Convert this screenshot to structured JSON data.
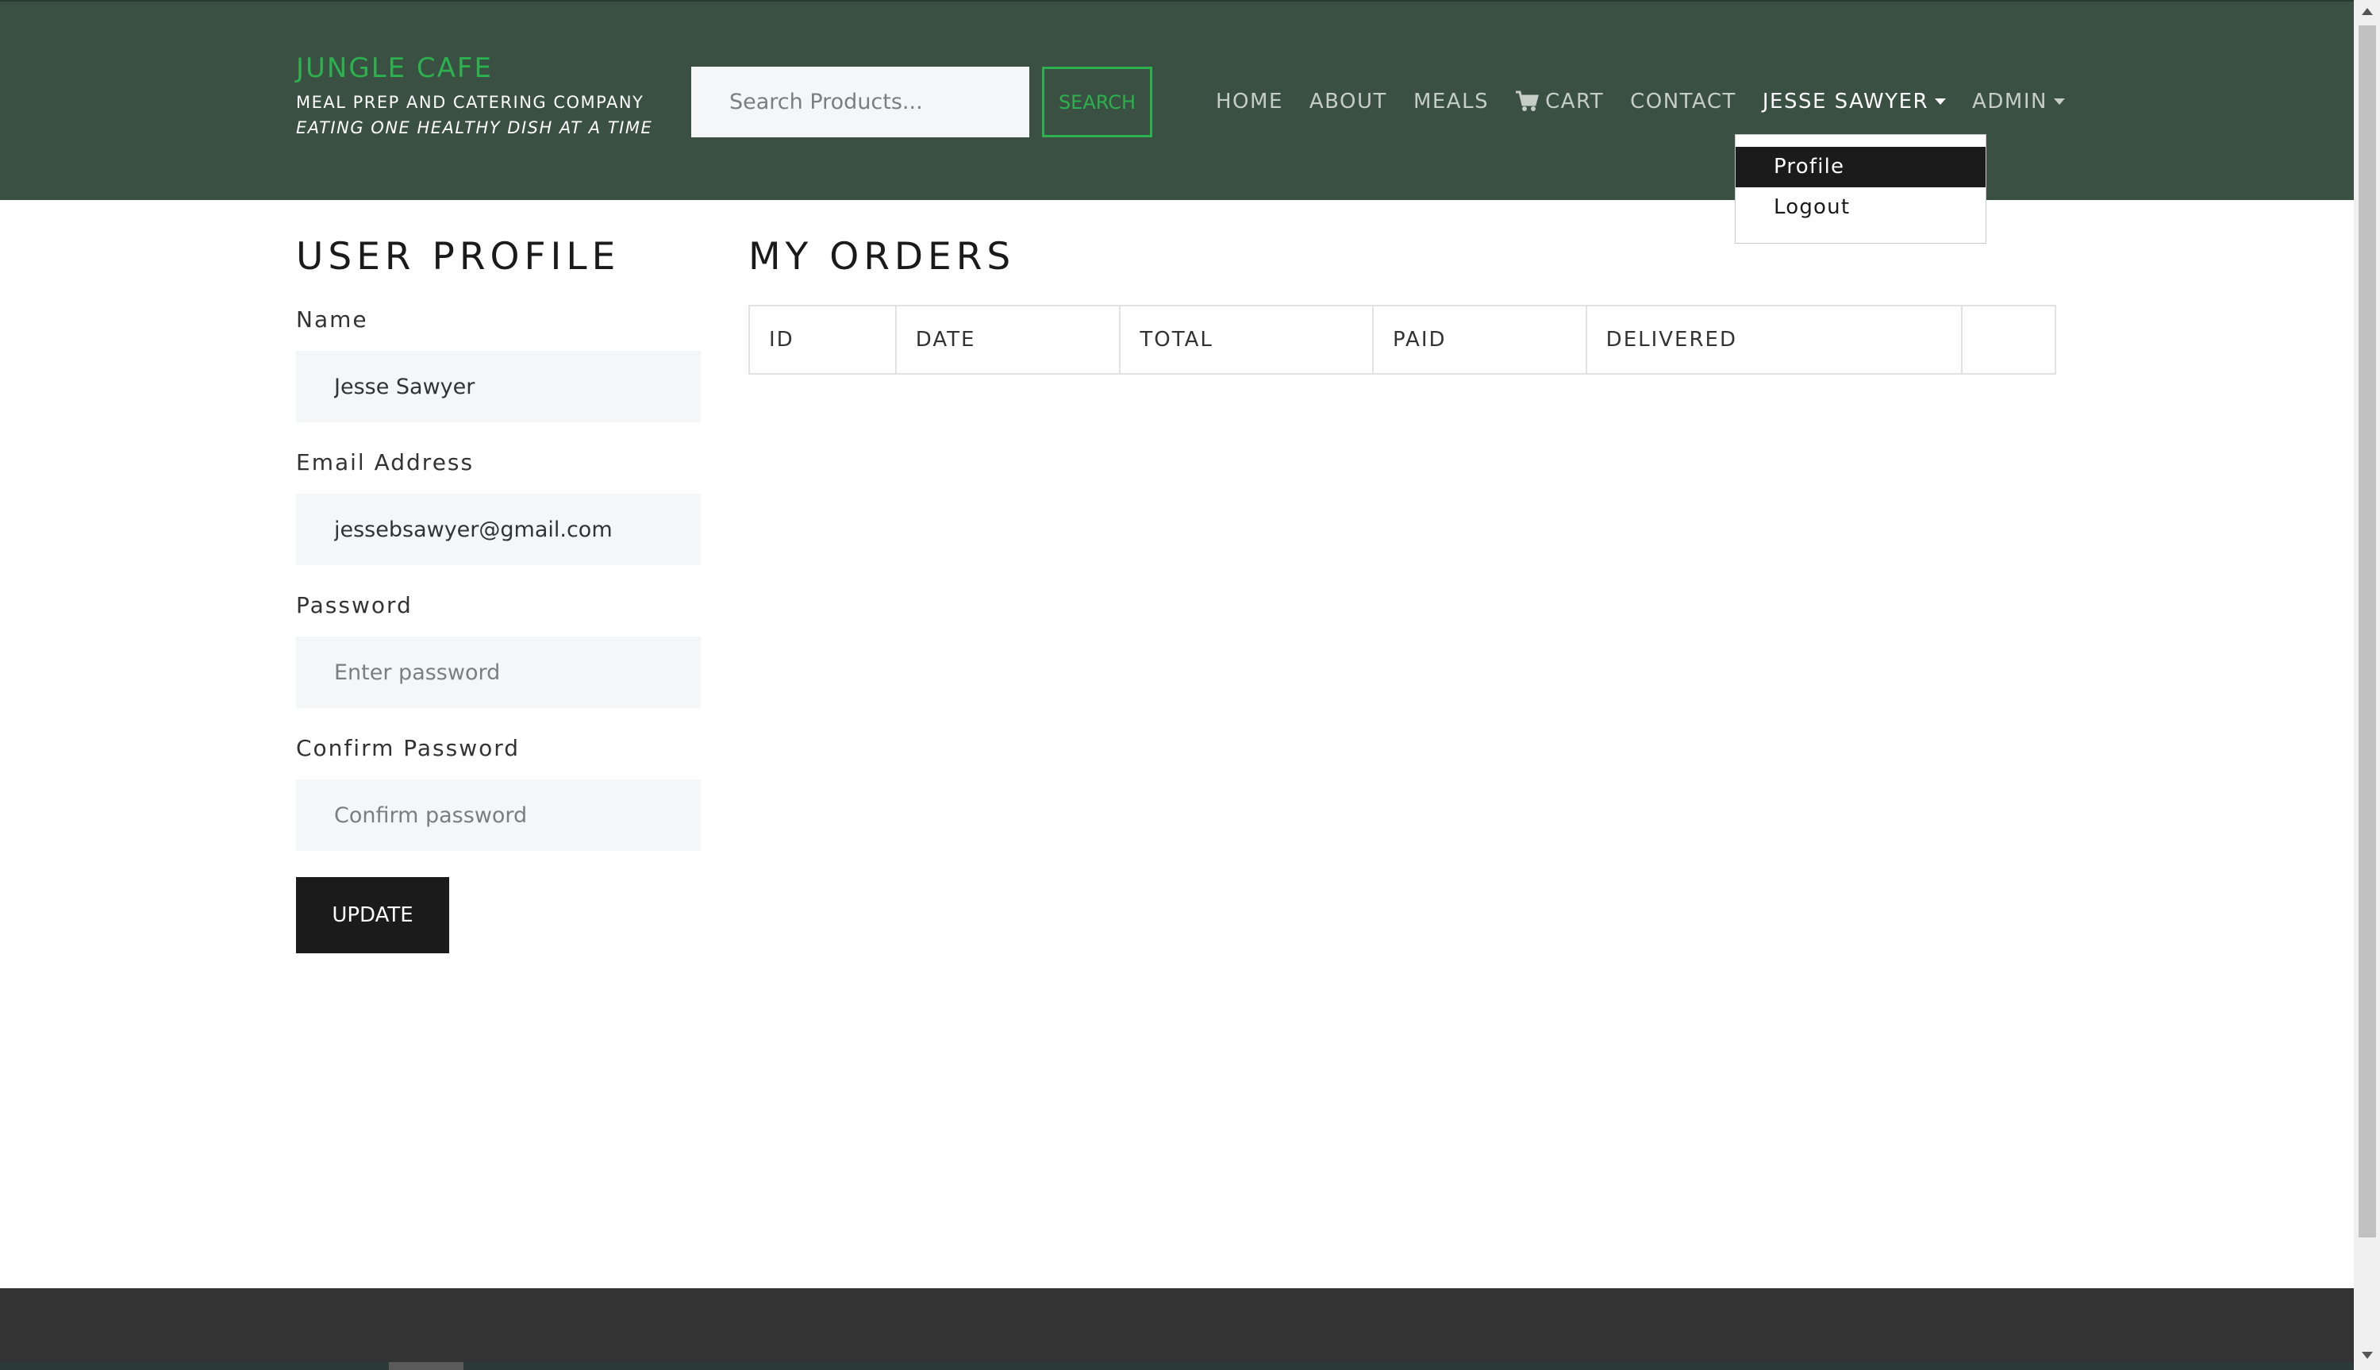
{
  "navbar": {
    "brand": {
      "name": "JUNGLE CAFE",
      "subtitle": "MEAL PREP AND CATERING COMPANY",
      "tagline": "EATING ONE HEALTHY DISH AT A TIME"
    },
    "search": {
      "placeholder": "Search Products...",
      "button_label": "SEARCH"
    },
    "links": {
      "home": "HOME",
      "about": "ABOUT",
      "meals": "MEALS",
      "cart": "CART",
      "contact": "CONTACT",
      "user": "JESSE SAWYER",
      "admin": "ADMIN"
    },
    "user_menu": {
      "profile": "Profile",
      "logout": "Logout"
    }
  },
  "profile": {
    "title": "USER PROFILE",
    "name_label": "Name",
    "name_value": "Jesse Sawyer",
    "email_label": "Email Address",
    "email_value": "jessebsawyer@gmail.com",
    "password_label": "Password",
    "password_placeholder": "Enter password",
    "confirm_label": "Confirm Password",
    "confirm_placeholder": "Confirm password",
    "update_label": "UPDATE"
  },
  "orders": {
    "title": "MY ORDERS",
    "columns": [
      "ID",
      "DATE",
      "TOTAL",
      "PAID",
      "DELIVERED",
      ""
    ]
  },
  "icons": {
    "cart": "shopping-cart-icon"
  },
  "colors": {
    "navbar": "#3a5042",
    "brand_green": "#2bb14e",
    "dark": "#1b1b1b",
    "footer": "#333333"
  }
}
